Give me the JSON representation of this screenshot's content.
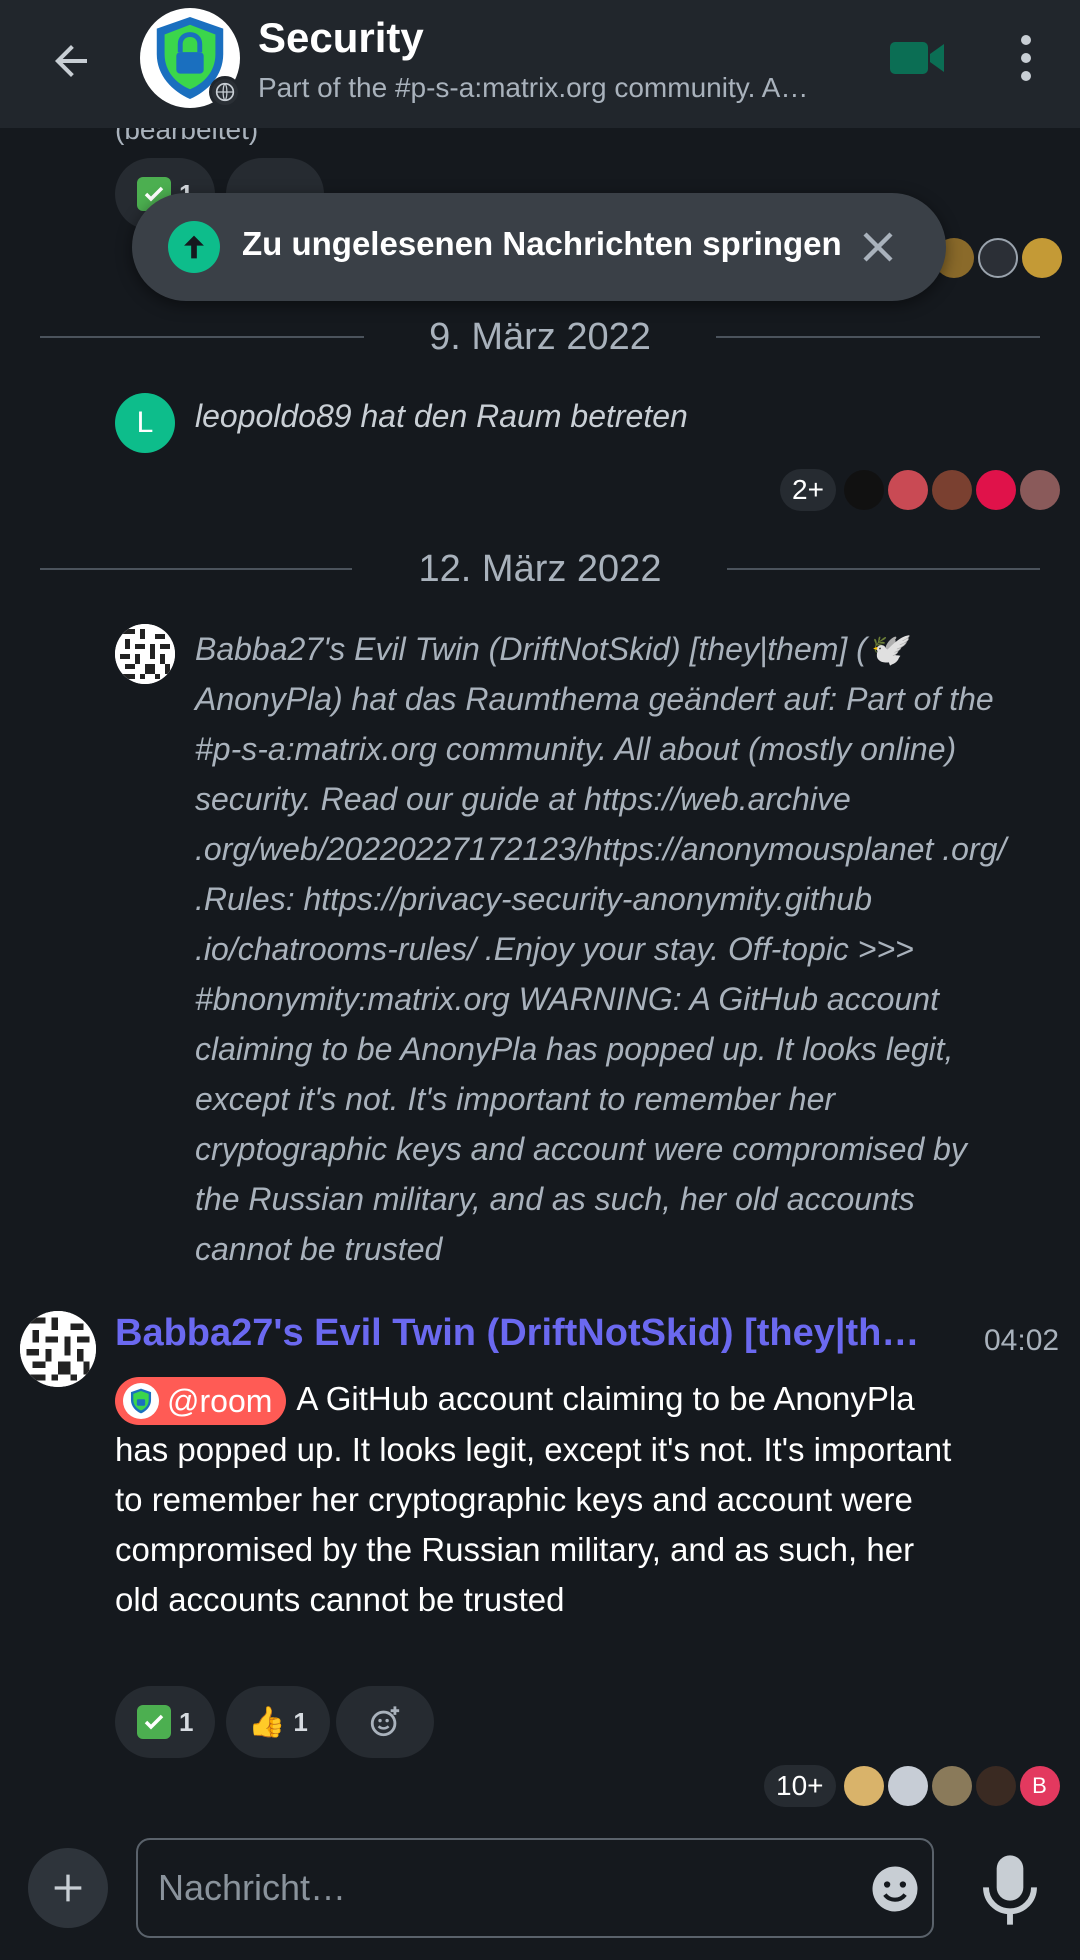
{
  "header": {
    "back_label": "←",
    "title": "Security",
    "topic": "Part of the #p-s-a:matrix.org community. A…"
  },
  "unread_banner": {
    "text": "Zu ungelesenen Nachrichten springen"
  },
  "timeline": {
    "prev_edited": "(bearbeitet)",
    "prev_reactions": [
      {
        "emoji": "✅",
        "count": "1"
      }
    ],
    "date_1": "9. März 2022",
    "join_avatar_letter": "L",
    "join_event": "leopoldo89 hat den Raum betreten",
    "read_more_1": "2+",
    "date_2": "12. März 2022",
    "topic_change": "Babba27's Evil Twin (DriftNotSkid) [they|them] (🕊️ AnonyPla) hat das Raumthema geändert auf: Part of the #p-s-a:matrix.org community. All about (mostly online) security. Read our guide at https://web.archive .org/web/20220227172123/https://anonymousplanet .org/ .Rules: https://privacy-security-anonymity.github .io/chatrooms-rules/ .Enjoy your stay. Off-topic >>> #bnonymity:matrix.org WARNING: A GitHub account claiming to be AnonyPla has popped up. It looks legit, except it's not. It's important to remember her cryptographic keys and account were compromised by the Russian military, and as such, her old accounts cannot be trusted",
    "message": {
      "sender": "Babba27's Evil Twin (DriftNotSkid) [they|the…",
      "time": "04:02",
      "mention": "@room",
      "body": "A GitHub account claiming to be AnonyPla has popped up. It looks legit, except it's not. It's important to remember her cryptographic keys and account were compromised by the Russian military, and as such, her old accounts cannot be trusted",
      "reactions": [
        {
          "emoji": "✅",
          "count": "1"
        },
        {
          "emoji": "👍",
          "count": "1"
        }
      ]
    },
    "read_more_2": "10+",
    "read_avatar_letter": "B"
  },
  "composer": {
    "placeholder": "Nachricht…"
  },
  "colors": {
    "accent_green": "#0dbd8b",
    "sender_purple": "#6b69f0",
    "mention_red": "#ff5b55",
    "background": "#15191e"
  }
}
